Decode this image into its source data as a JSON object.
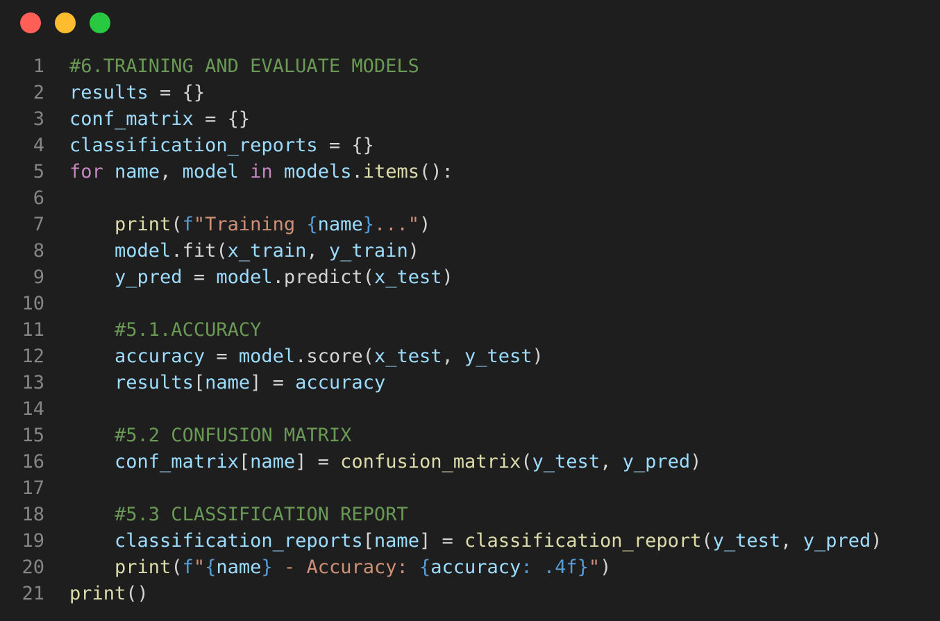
{
  "window": {
    "controls": [
      {
        "name": "close",
        "color": "#ff5f57"
      },
      {
        "name": "minimize",
        "color": "#febc2e"
      },
      {
        "name": "maximize",
        "color": "#28c840"
      }
    ]
  },
  "editor": {
    "language": "python",
    "indent": "    ",
    "lines": [
      {
        "number": "1",
        "indent": 0,
        "tokens": [
          {
            "t": "#6.TRAINING AND EVALUATE MODELS",
            "k": "comment"
          }
        ]
      },
      {
        "number": "2",
        "indent": 0,
        "tokens": [
          {
            "t": "results",
            "k": "var"
          },
          {
            "t": " = {}",
            "k": "op"
          }
        ]
      },
      {
        "number": "3",
        "indent": 0,
        "tokens": [
          {
            "t": "conf_matrix",
            "k": "var"
          },
          {
            "t": " = {}",
            "k": "op"
          }
        ]
      },
      {
        "number": "4",
        "indent": 0,
        "tokens": [
          {
            "t": "classification_reports",
            "k": "var"
          },
          {
            "t": " = {}",
            "k": "op"
          }
        ]
      },
      {
        "number": "5",
        "indent": 0,
        "tokens": [
          {
            "t": "for",
            "k": "keyword"
          },
          {
            "t": " ",
            "k": "op"
          },
          {
            "t": "name",
            "k": "var"
          },
          {
            "t": ", ",
            "k": "op"
          },
          {
            "t": "model",
            "k": "var"
          },
          {
            "t": " ",
            "k": "op"
          },
          {
            "t": "in",
            "k": "keyword"
          },
          {
            "t": " ",
            "k": "op"
          },
          {
            "t": "models",
            "k": "var"
          },
          {
            "t": ".",
            "k": "op"
          },
          {
            "t": "items",
            "k": "func"
          },
          {
            "t": "():",
            "k": "op"
          }
        ]
      },
      {
        "number": "6",
        "indent": 0,
        "tokens": []
      },
      {
        "number": "7",
        "indent": 1,
        "tokens": [
          {
            "t": "print",
            "k": "func"
          },
          {
            "t": "(",
            "k": "op"
          },
          {
            "t": "f",
            "k": "fprefix"
          },
          {
            "t": "\"Training ",
            "k": "string"
          },
          {
            "t": "{",
            "k": "brace"
          },
          {
            "t": "name",
            "k": "var"
          },
          {
            "t": "}",
            "k": "brace"
          },
          {
            "t": "...\"",
            "k": "string"
          },
          {
            "t": ")",
            "k": "op"
          }
        ]
      },
      {
        "number": "8",
        "indent": 1,
        "tokens": [
          {
            "t": "model",
            "k": "var"
          },
          {
            "t": ".fit(",
            "k": "op"
          },
          {
            "t": "x_train",
            "k": "var"
          },
          {
            "t": ", ",
            "k": "op"
          },
          {
            "t": "y_train",
            "k": "var"
          },
          {
            "t": ")",
            "k": "op"
          }
        ]
      },
      {
        "number": "9",
        "indent": 1,
        "tokens": [
          {
            "t": "y_pred",
            "k": "var"
          },
          {
            "t": " = ",
            "k": "op"
          },
          {
            "t": "model",
            "k": "var"
          },
          {
            "t": ".predict(",
            "k": "op"
          },
          {
            "t": "x_test",
            "k": "var"
          },
          {
            "t": ")",
            "k": "op"
          }
        ]
      },
      {
        "number": "10",
        "indent": 0,
        "tokens": []
      },
      {
        "number": "11",
        "indent": 1,
        "tokens": [
          {
            "t": "#5.1.ACCURACY",
            "k": "comment"
          }
        ]
      },
      {
        "number": "12",
        "indent": 1,
        "tokens": [
          {
            "t": "accuracy",
            "k": "var"
          },
          {
            "t": " = ",
            "k": "op"
          },
          {
            "t": "model",
            "k": "var"
          },
          {
            "t": ".score(",
            "k": "op"
          },
          {
            "t": "x_test",
            "k": "var"
          },
          {
            "t": ", ",
            "k": "op"
          },
          {
            "t": "y_test",
            "k": "var"
          },
          {
            "t": ")",
            "k": "op"
          }
        ]
      },
      {
        "number": "13",
        "indent": 1,
        "tokens": [
          {
            "t": "results",
            "k": "var"
          },
          {
            "t": "[",
            "k": "op"
          },
          {
            "t": "name",
            "k": "var"
          },
          {
            "t": "] = ",
            "k": "op"
          },
          {
            "t": "accuracy",
            "k": "var"
          }
        ]
      },
      {
        "number": "14",
        "indent": 0,
        "tokens": []
      },
      {
        "number": "15",
        "indent": 1,
        "tokens": [
          {
            "t": "#5.2 CONFUSION MATRIX",
            "k": "comment"
          }
        ]
      },
      {
        "number": "16",
        "indent": 1,
        "tokens": [
          {
            "t": "conf_matrix",
            "k": "var"
          },
          {
            "t": "[",
            "k": "op"
          },
          {
            "t": "name",
            "k": "var"
          },
          {
            "t": "] = ",
            "k": "op"
          },
          {
            "t": "confusion_matrix",
            "k": "func"
          },
          {
            "t": "(",
            "k": "op"
          },
          {
            "t": "y_test",
            "k": "var"
          },
          {
            "t": ", ",
            "k": "op"
          },
          {
            "t": "y_pred",
            "k": "var"
          },
          {
            "t": ")",
            "k": "op"
          }
        ]
      },
      {
        "number": "17",
        "indent": 0,
        "tokens": []
      },
      {
        "number": "18",
        "indent": 1,
        "tokens": [
          {
            "t": "#5.3 CLASSIFICATION REPORT",
            "k": "comment"
          }
        ]
      },
      {
        "number": "19",
        "indent": 1,
        "tokens": [
          {
            "t": "classification_reports",
            "k": "var"
          },
          {
            "t": "[",
            "k": "op"
          },
          {
            "t": "name",
            "k": "var"
          },
          {
            "t": "] = ",
            "k": "op"
          },
          {
            "t": "classification_report",
            "k": "func"
          },
          {
            "t": "(",
            "k": "op"
          },
          {
            "t": "y_test",
            "k": "var"
          },
          {
            "t": ", ",
            "k": "op"
          },
          {
            "t": "y_pred",
            "k": "var"
          },
          {
            "t": ")",
            "k": "op"
          }
        ]
      },
      {
        "number": "20",
        "indent": 1,
        "tokens": [
          {
            "t": "print",
            "k": "func"
          },
          {
            "t": "(",
            "k": "op"
          },
          {
            "t": "f",
            "k": "fprefix"
          },
          {
            "t": "\"",
            "k": "string"
          },
          {
            "t": "{",
            "k": "brace"
          },
          {
            "t": "name",
            "k": "var"
          },
          {
            "t": "}",
            "k": "brace"
          },
          {
            "t": " - Accuracy: ",
            "k": "string"
          },
          {
            "t": "{",
            "k": "brace"
          },
          {
            "t": "accuracy",
            "k": "var"
          },
          {
            "t": ": .4f",
            "k": "fmt"
          },
          {
            "t": "}",
            "k": "brace"
          },
          {
            "t": "\"",
            "k": "string"
          },
          {
            "t": ")",
            "k": "op"
          }
        ]
      },
      {
        "number": "21",
        "indent": 0,
        "tokens": [
          {
            "t": "print",
            "k": "func"
          },
          {
            "t": "()",
            "k": "op"
          }
        ]
      }
    ]
  }
}
